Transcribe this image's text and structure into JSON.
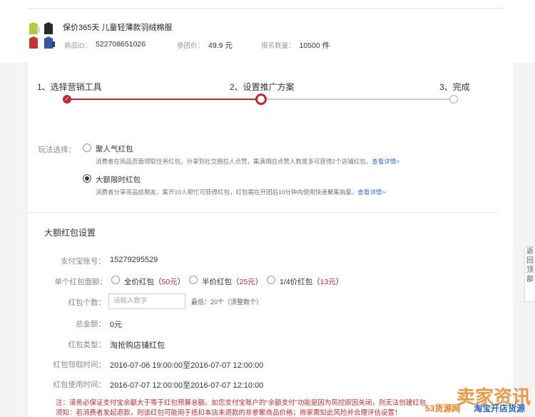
{
  "product": {
    "title": "保价365天 儿童轻薄款羽绒棉服",
    "id_label": "商品ID：",
    "id_value": "522708651026",
    "price_label": "参团价：",
    "price_value": "49.9 元",
    "quantity_label": "报名数量：",
    "quantity_value": "10500 件"
  },
  "steps": [
    {
      "label": "1、选择营销工具"
    },
    {
      "label": "2、设置推广方案"
    },
    {
      "label": "3、完成"
    }
  ],
  "play_mode": {
    "label": "玩法选择：",
    "options": [
      {
        "title": "聚人气红包",
        "desc": "消费者在商品页面领取任务红包，分享到社交圈拉人点赞，集满相应点赞人数是多可获得2个店铺红包。",
        "link": "查看详情>"
      },
      {
        "title": "大额限时红包",
        "desc": "消费者分享商品给朋友，集齐10人帮忙可获得红包，红包需在开团后10分钟内使用快速聚集销量。",
        "link": "查看详情>"
      }
    ]
  },
  "settings": {
    "title": "大额红包设置",
    "alipay_label": "支付宝账号：",
    "alipay_value": "15279295529",
    "denomination_label": "单个红包面额：",
    "denomination_options": [
      {
        "prefix": "全价红包（",
        "amount": "50元",
        "suffix": "）"
      },
      {
        "prefix": "半价红包（",
        "amount": "25元",
        "suffix": "）"
      },
      {
        "prefix": "1/4价红包（",
        "amount": "13元",
        "suffix": "）"
      }
    ],
    "count_label": "红包个数：",
    "count_placeholder": "请输入数字",
    "count_hint": "最低：20个（须整数个）",
    "total_label": "总金额：",
    "total_value": "0元",
    "type_label": "红包类型：",
    "type_value": "淘抢购店铺红包",
    "claim_label": "红包领取时间：",
    "claim_value": "2016-07-06 19:00:00至2016-07-07 12:00:00",
    "use_label": "红包使用时间：",
    "use_value": "2016-07-07 12:00:00至2016-07-07 12:10:00"
  },
  "notices": [
    "注：请务必保证支付宝余额大于等于红包预算总额。如您支付宝账户的“余额支付”功能是因为风控原因关闭，则无法创建红包",
    "须知：若消费者发起退款，则该红包可能用于抵扣本店未退款的非参聚商品价格；商家需知此风险并合理评估设置！"
  ],
  "side_tab_text": "返回顶部",
  "watermark": {
    "main": "卖家资讯",
    "site": "53货源网",
    "tagline": "淘宝开店货源"
  },
  "colors": {
    "accent": "#c0282f",
    "link": "#3a72c6",
    "step_inactive": "#cccccc"
  }
}
